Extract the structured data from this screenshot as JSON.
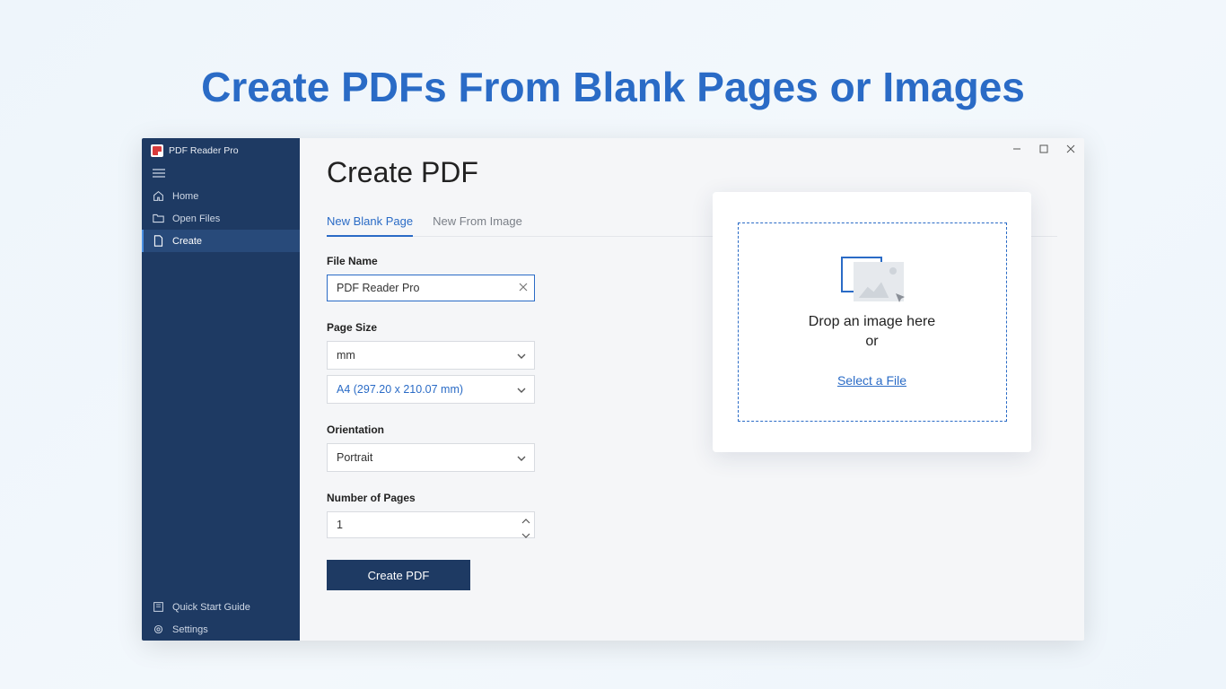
{
  "hero": {
    "title": "Create PDFs From Blank Pages or Images"
  },
  "app": {
    "name": "PDF Reader Pro"
  },
  "sidebar": {
    "items": [
      {
        "label": "Home"
      },
      {
        "label": "Open Files"
      },
      {
        "label": "Create"
      }
    ],
    "bottom": [
      {
        "label": "Quick Start Guide"
      },
      {
        "label": "Settings"
      }
    ]
  },
  "main": {
    "title": "Create PDF",
    "tabs": [
      {
        "label": "New Blank Page",
        "active": true
      },
      {
        "label": "New From Image",
        "active": false
      }
    ],
    "file_name": {
      "label": "File Name",
      "value": "PDF Reader Pro"
    },
    "page_size": {
      "label": "Page Size",
      "unit": "mm",
      "preset": "A4 (297.20 x 210.07 mm)"
    },
    "orientation": {
      "label": "Orientation",
      "value": "Portrait"
    },
    "num_pages": {
      "label": "Number of Pages",
      "value": "1"
    },
    "create_button": "Create PDF"
  },
  "drop": {
    "line1": "Drop an image here",
    "line2": "or",
    "link": "Select a File"
  }
}
